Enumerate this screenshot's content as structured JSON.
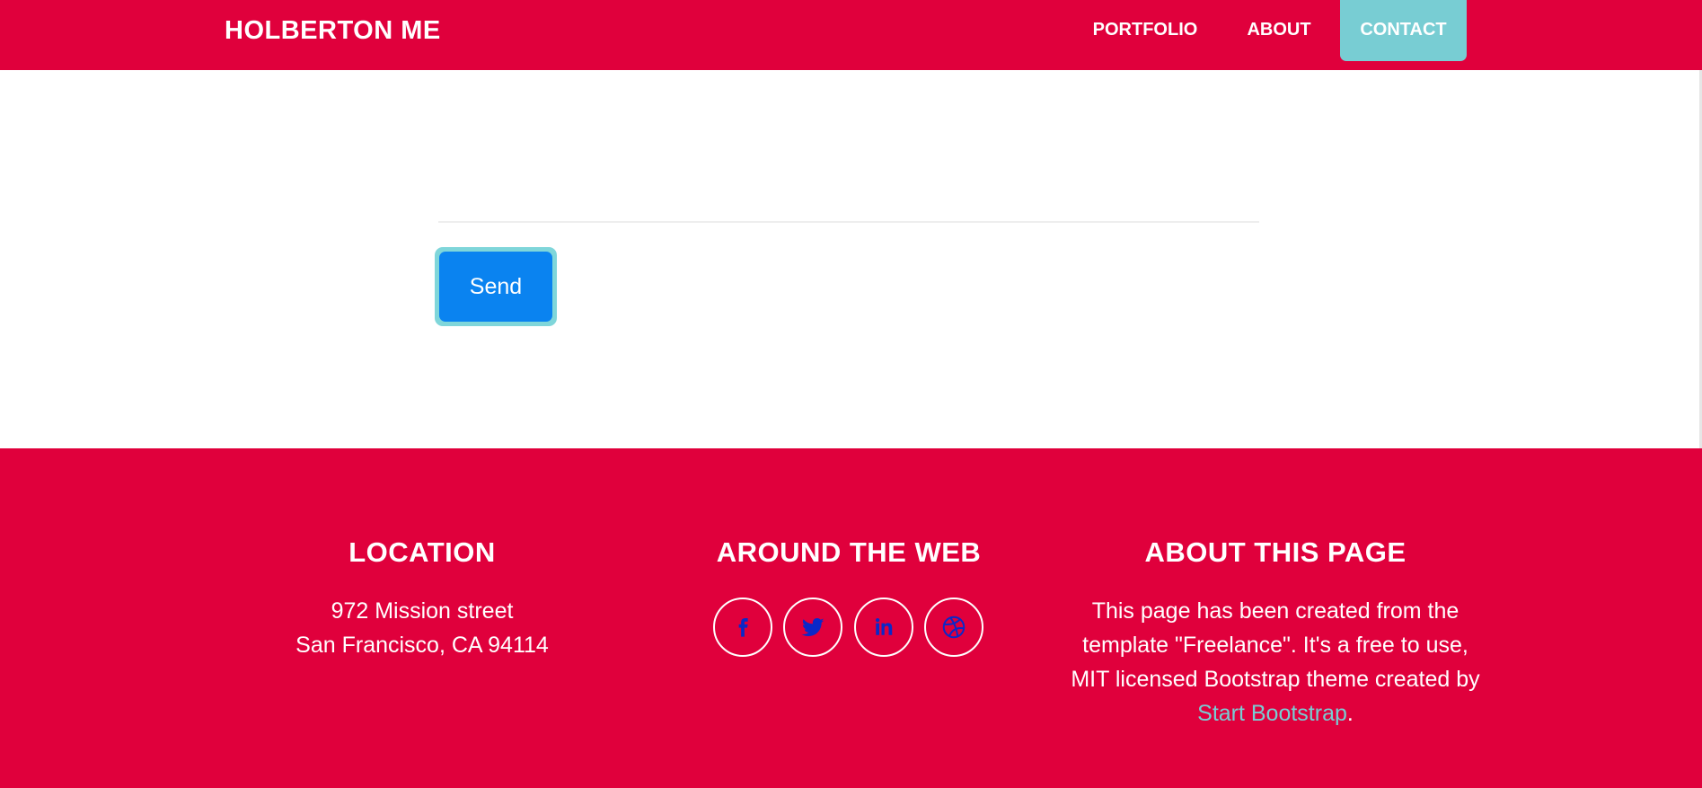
{
  "navbar": {
    "brand": "HOLBERTON ME",
    "links": [
      {
        "label": "PORTFOLIO"
      },
      {
        "label": "ABOUT"
      },
      {
        "label": "CONTACT"
      }
    ],
    "accent_color": "#78cdd3",
    "bg_color": "#e0003c"
  },
  "form": {
    "send_label": "Send",
    "send_color": "#0a83f0"
  },
  "footer": {
    "location": {
      "title": "LOCATION",
      "line1": "972 Mission street",
      "line2": "San Francisco, CA 94114"
    },
    "web": {
      "title": "AROUND THE WEB",
      "icons": [
        "facebook-icon",
        "twitter-icon",
        "linkedin-icon",
        "dribbble-icon"
      ]
    },
    "about": {
      "title": "ABOUT THIS PAGE",
      "text": "This page has been created from the template \"Freelance\". It's a free to use, MIT licensed Bootstrap theme created by ",
      "link_text": "Start Bootstrap",
      "trailing": "."
    }
  }
}
